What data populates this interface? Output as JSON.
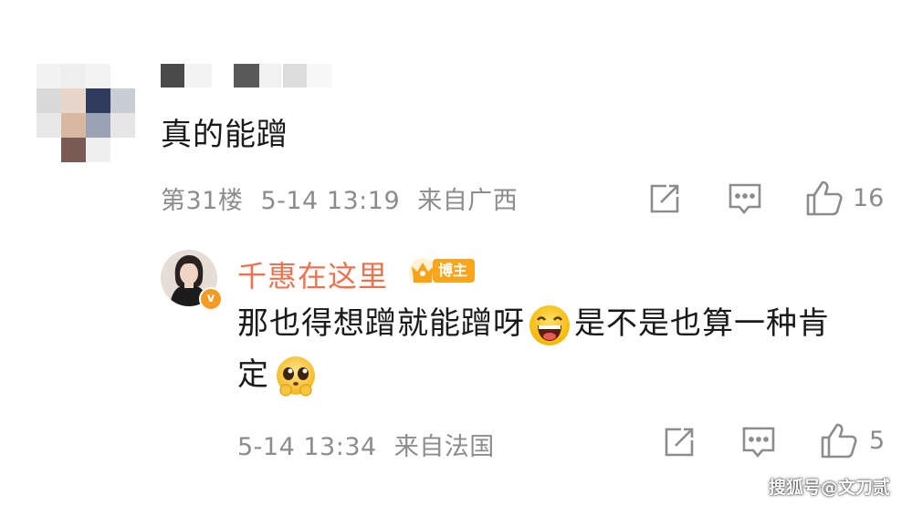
{
  "comment": {
    "text": "真的能蹭",
    "floor": "第31楼",
    "time": "5-14 13:19",
    "location": "来自广西",
    "like_count": "16"
  },
  "reply": {
    "author": "千惠在这里",
    "badge_label": "博主",
    "verified_mark": "v",
    "text_part1": "那也得想蹭就能蹭呀",
    "text_part2": "是不是也算一种肯",
    "text_part3": "定",
    "time": "5-14 13:34",
    "location": "来自法国",
    "like_count": "5"
  },
  "icons": {
    "share": "share-icon",
    "comment": "comment-icon",
    "like": "thumbs-up-icon",
    "emoji_laugh": "laughing-emoji-icon",
    "emoji_plead": "pleading-emoji-icon",
    "crown": "crown-icon"
  },
  "colors": {
    "author_name": "#eb7350",
    "meta_text": "#8c8c8c",
    "body_text": "#1a1a1a",
    "badge": "#fba51f"
  },
  "watermark": "搜狐号@文刀贰"
}
